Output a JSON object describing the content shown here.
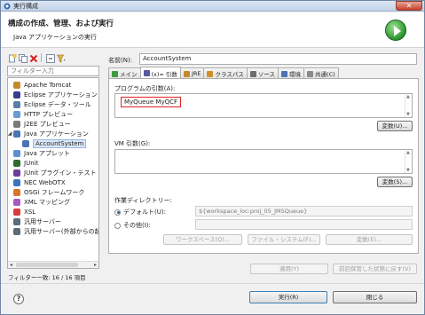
{
  "window": {
    "title": "実行構成"
  },
  "header": {
    "title": "構成の作成、管理、および実行",
    "subtitle": "Java アプリケーションの実行",
    "icon": "run-icon"
  },
  "toolbar": {
    "icons": [
      "new-config-icon",
      "duplicate-icon",
      "delete-icon",
      "collapse-icon",
      "filter-icon"
    ]
  },
  "filter": {
    "placeholder": "フィルター入力"
  },
  "tree": {
    "items": [
      {
        "label": "Apache Tomcat",
        "icon": "tomcat-icon",
        "level": 1
      },
      {
        "label": "Eclipse アプリケーション",
        "icon": "eclipse-icon",
        "level": 1
      },
      {
        "label": "Eclipse データ・ツール",
        "icon": "data-tool-icon",
        "level": 1
      },
      {
        "label": "HTTP プレビュー",
        "icon": "http-icon",
        "level": 1
      },
      {
        "label": "J2EE プレビュー",
        "icon": "j2ee-icon",
        "level": 1
      },
      {
        "label": "Java アプリケーション",
        "icon": "java-app-icon",
        "level": 1,
        "expanded": true
      },
      {
        "label": "AccountSystem",
        "icon": "java-config-icon",
        "level": 2,
        "selected": true
      },
      {
        "label": "Java アプレット",
        "icon": "applet-icon",
        "level": 1
      },
      {
        "label": "JUnit",
        "icon": "junit-icon",
        "level": 1
      },
      {
        "label": "JUnit プラグイン・テスト",
        "icon": "junit-plugin-icon",
        "level": 1
      },
      {
        "label": "NEC WebOTX",
        "icon": "webotx-icon",
        "level": 1
      },
      {
        "label": "OSGi フレームワーク",
        "icon": "osgi-icon",
        "level": 1
      },
      {
        "label": "XML マッピング",
        "icon": "xml-mapping-icon",
        "level": 1
      },
      {
        "label": "XSL",
        "icon": "xsl-icon",
        "level": 1
      },
      {
        "label": "汎用サーバー",
        "icon": "server-icon",
        "level": 1
      },
      {
        "label": "汎用サーバー(外部からの起",
        "icon": "server-ext-icon",
        "level": 1
      }
    ],
    "status": "フィルター一致: 16 / 16 項目"
  },
  "config": {
    "name_label": "名前(N):",
    "name_value": "AccountSystem",
    "tabs": [
      {
        "label": "メイン",
        "icon": "main-tab-icon"
      },
      {
        "label": "(x)= 引数",
        "icon": "args-tab-icon",
        "active": true
      },
      {
        "label": "JRE",
        "icon": "jre-tab-icon"
      },
      {
        "label": "クラスパス",
        "icon": "classpath-tab-icon"
      },
      {
        "label": "ソース",
        "icon": "source-tab-icon"
      },
      {
        "label": "環境",
        "icon": "env-tab-icon"
      },
      {
        "label": "共通(C)",
        "icon": "common-tab-icon"
      }
    ],
    "program_args_label": "プログラムの引数(A):",
    "program_args_value": "MyQueue MyQCF",
    "variables_button_1": "変数(U)...",
    "vm_args_label": "VM 引数(G):",
    "variables_button_2": "変数(S)...",
    "workdir_label": "作業ディレクトリー:",
    "default_radio": "デフォルト(U):",
    "default_value": "${workspace_loc:proj_05_JMSQueue}",
    "other_radio": "その他(I):",
    "workspace_button": "ワークスペース(Q)...",
    "filesystem_button": "ファイル・システム(F)...",
    "variables_button_3": "変数(E)..."
  },
  "actions": {
    "apply": "適用(Y)",
    "revert": "前回保管した状態に戻す(V)",
    "run": "実行(R)",
    "close": "閉じる"
  }
}
